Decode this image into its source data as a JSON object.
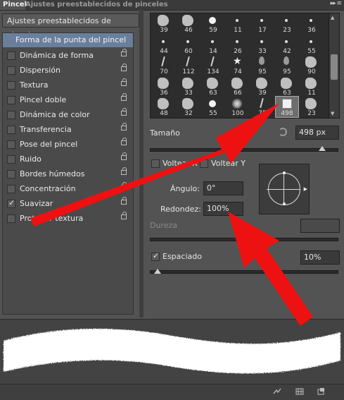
{
  "tabs": {
    "active": "Pincel",
    "inactive": "Ajustes preestablecidos de pinceles",
    "menu_glyph": "▸▸ ≡"
  },
  "preset_button": "Ajustes preestablecidos de pinceles",
  "left_header": "Forma de la punta del pincel",
  "options": [
    {
      "label": "Dinámica de forma",
      "checked": false
    },
    {
      "label": "Dispersión",
      "checked": false
    },
    {
      "label": "Textura",
      "checked": false
    },
    {
      "label": "Pincel doble",
      "checked": false
    },
    {
      "label": "Dinámica de color",
      "checked": false
    },
    {
      "label": "Transferencia",
      "checked": false
    },
    {
      "label": "Pose del pincel",
      "checked": false
    },
    {
      "label": "Ruido",
      "checked": false
    },
    {
      "label": "Bordes húmedos",
      "checked": false
    },
    {
      "label": "Concentración",
      "checked": false
    },
    {
      "label": "Suavizar",
      "checked": true
    },
    {
      "label": "Proteger textura",
      "checked": false
    }
  ],
  "brushes": [
    [
      "39",
      "46",
      "59",
      "11",
      "17",
      "23",
      "36"
    ],
    [
      "44",
      "60",
      "14",
      "26",
      "33",
      "42",
      "55"
    ],
    [
      "70",
      "112",
      "134",
      "74",
      "95",
      "95",
      "90"
    ],
    [
      "36",
      "33",
      "63",
      "66",
      "39",
      "63",
      "11"
    ],
    [
      "48",
      "32",
      "55",
      "100",
      "75",
      "498",
      "23"
    ]
  ],
  "selected_brush": "498",
  "size": {
    "label": "Tamaño",
    "value": "498 px",
    "slider_percent": 92
  },
  "flip_x": {
    "label": "Voltear X",
    "checked": false
  },
  "flip_y": {
    "label": "Voltear Y",
    "checked": false
  },
  "angle": {
    "label": "Ángulo:",
    "value": "0°"
  },
  "roundness": {
    "label": "Redondez:",
    "value": "100%"
  },
  "hardness": {
    "label": "Dureza",
    "value": ""
  },
  "spacing": {
    "label": "Espaciado",
    "checked": true,
    "value": "10%",
    "slider_percent": 4
  },
  "colors": {
    "panel_bg": "#535353",
    "header_selected": "#6b7f9c",
    "arrow": "#ee1111"
  }
}
